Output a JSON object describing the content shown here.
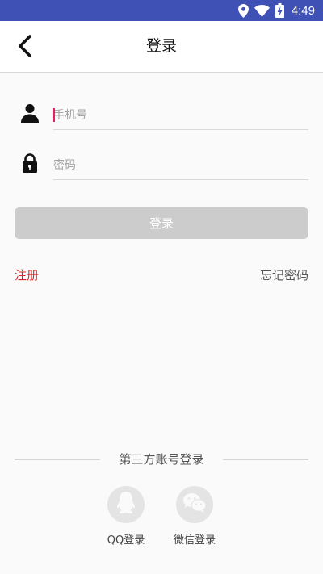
{
  "status_bar": {
    "time": "4:49",
    "background_color": "#3f51b5",
    "icons": [
      "location-icon",
      "wifi-icon",
      "battery-charging-icon"
    ]
  },
  "header": {
    "title": "登录",
    "back_icon": "back-arrow-icon"
  },
  "form": {
    "phone": {
      "placeholder": "手机号",
      "value": "",
      "icon": "user-icon"
    },
    "password": {
      "placeholder": "密码",
      "value": "",
      "icon": "lock-icon"
    },
    "login_button_label": "登录"
  },
  "links": {
    "register": "注册",
    "forgot_password": "忘记密码",
    "register_color": "#e02020"
  },
  "third_party": {
    "title": "第三方账号登录",
    "items": [
      {
        "label": "QQ登录",
        "icon": "qq-icon"
      },
      {
        "label": "微信登录",
        "icon": "wechat-icon"
      }
    ]
  }
}
